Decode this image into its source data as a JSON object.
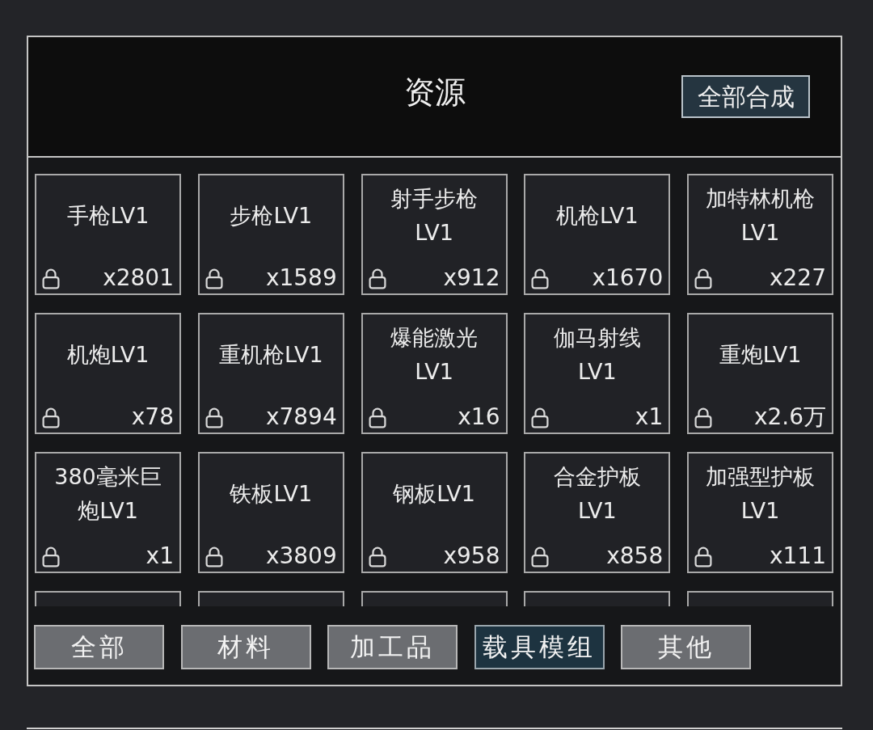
{
  "header": {
    "title": "资源",
    "action_button": "全部合成"
  },
  "items": [
    {
      "kind": "item",
      "name": "手枪LV1",
      "count": "x2801",
      "locked": true
    },
    {
      "kind": "item",
      "name": "步枪LV1",
      "count": "x1589",
      "locked": true
    },
    {
      "kind": "item",
      "name": "射手步枪LV1",
      "count": "x912",
      "locked": true
    },
    {
      "kind": "item",
      "name": "机枪LV1",
      "count": "x1670",
      "locked": true
    },
    {
      "kind": "item",
      "name": "加特林机枪LV1",
      "count": "x227",
      "locked": true
    },
    {
      "kind": "item",
      "name": "机炮LV1",
      "count": "x78",
      "locked": true
    },
    {
      "kind": "item",
      "name": "重机枪LV1",
      "count": "x7894",
      "locked": true
    },
    {
      "kind": "item",
      "name": "爆能激光LV1",
      "count": "x16",
      "locked": true
    },
    {
      "kind": "item",
      "name": "伽马射线LV1",
      "count": "x1",
      "locked": true
    },
    {
      "kind": "item",
      "name": "重炮LV1",
      "count": "x2.6万",
      "locked": true
    },
    {
      "kind": "item",
      "name": "380毫米巨炮LV1",
      "count": "x1",
      "locked": true
    },
    {
      "kind": "item",
      "name": "铁板LV1",
      "count": "x3809",
      "locked": true
    },
    {
      "kind": "item",
      "name": "钢板LV1",
      "count": "x958",
      "locked": true
    },
    {
      "kind": "item",
      "name": "合金护板LV1",
      "count": "x858",
      "locked": true
    },
    {
      "kind": "item",
      "name": "加强型护板LV1",
      "count": "x111",
      "locked": true
    },
    {
      "kind": "clipped"
    },
    {
      "kind": "clipped"
    },
    {
      "kind": "clipped"
    },
    {
      "kind": "clipped"
    },
    {
      "kind": "clipped"
    }
  ],
  "tabs": [
    {
      "label": "全部",
      "selected": false
    },
    {
      "label": "材料",
      "selected": false
    },
    {
      "label": "加工品",
      "selected": false
    },
    {
      "label": "载具模组",
      "selected": true
    },
    {
      "label": "其他",
      "selected": false
    }
  ]
}
